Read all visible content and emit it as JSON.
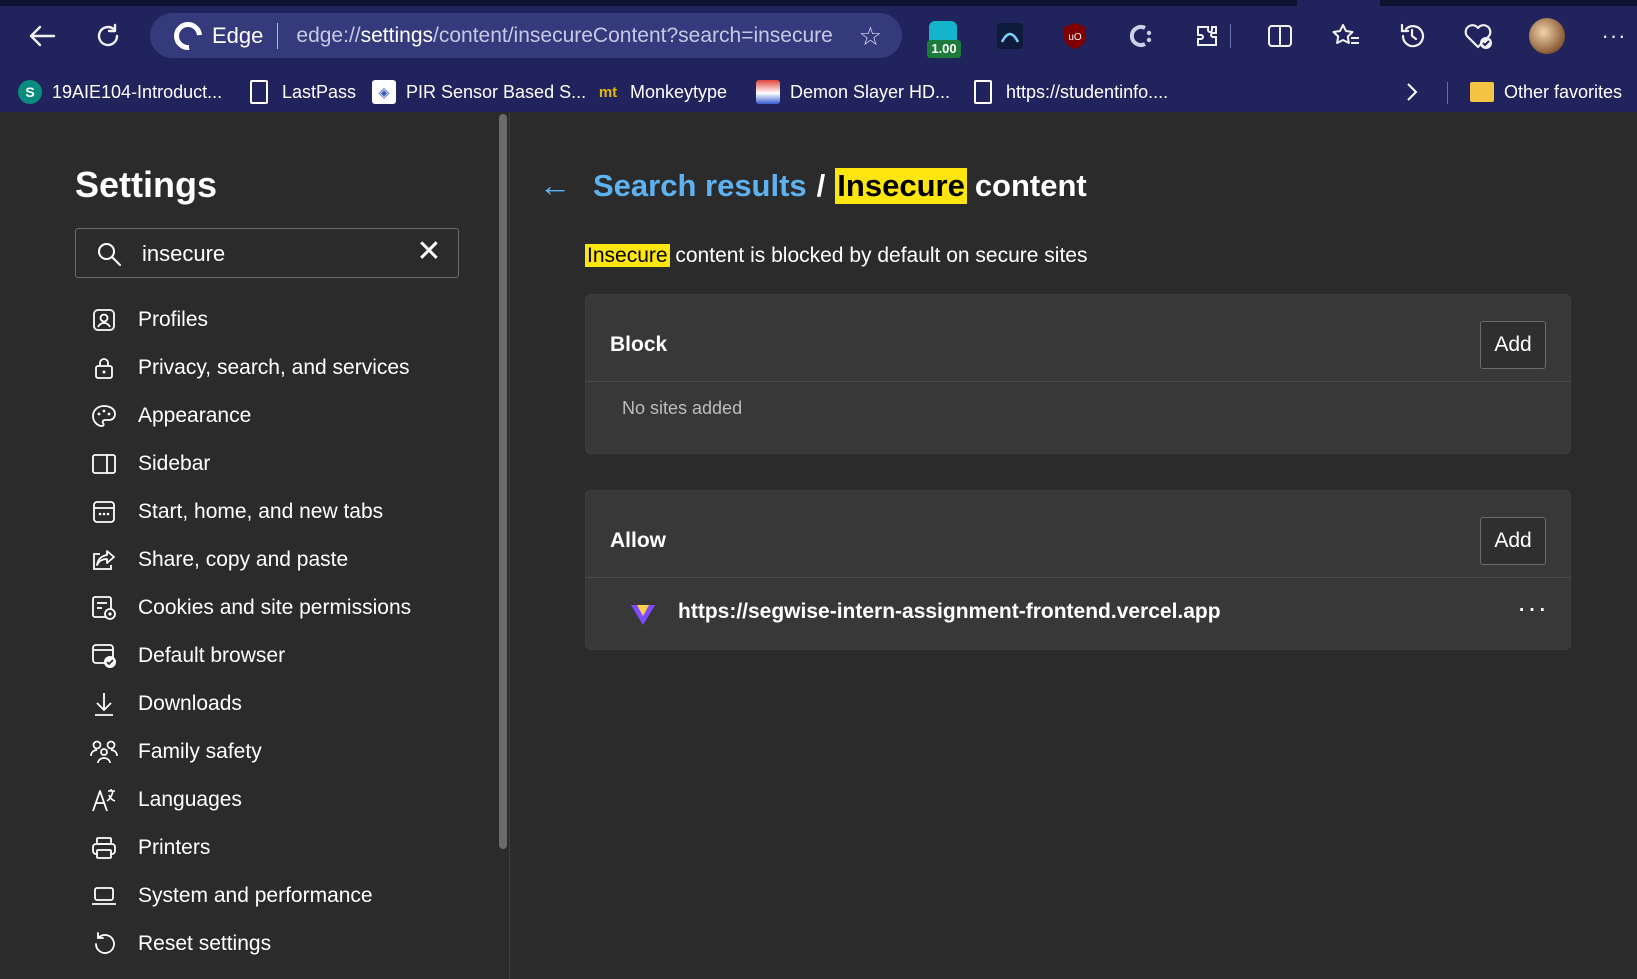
{
  "browser": {
    "brand": "Edge",
    "url_prefix": "edge://",
    "url_host": "settings",
    "url_path": "/content/insecureContent?search=insecure",
    "extension_badge": "1.00"
  },
  "favorites": {
    "items": [
      {
        "label": "19AIE104-Introduct...",
        "icon": "sharepoint-icon"
      },
      {
        "label": "LastPass",
        "icon": "document-icon"
      },
      {
        "label": "PIR Sensor Based S...",
        "icon": "site-icon"
      },
      {
        "label": "Monkeytype",
        "icon": "monkeytype-icon"
      },
      {
        "label": "Demon Slayer HD...",
        "icon": "site-icon"
      },
      {
        "label": "https://studentinfo....",
        "icon": "document-icon"
      }
    ],
    "other_label": "Other favorites"
  },
  "sidebar": {
    "title": "Settings",
    "search_value": "insecure",
    "items": [
      {
        "label": "Profiles"
      },
      {
        "label": "Privacy, search, and services"
      },
      {
        "label": "Appearance"
      },
      {
        "label": "Sidebar"
      },
      {
        "label": "Start, home, and new tabs"
      },
      {
        "label": "Share, copy and paste"
      },
      {
        "label": "Cookies and site permissions"
      },
      {
        "label": "Default browser"
      },
      {
        "label": "Downloads"
      },
      {
        "label": "Family safety"
      },
      {
        "label": "Languages"
      },
      {
        "label": "Printers"
      },
      {
        "label": "System and performance"
      },
      {
        "label": "Reset settings"
      }
    ]
  },
  "main": {
    "breadcrumb_link": "Search results",
    "breadcrumb_sep": "/",
    "breadcrumb_highlight": "Insecure",
    "breadcrumb_rest": "content",
    "subtitle_highlight": "Insecure",
    "subtitle_rest": " content is blocked by default on secure sites",
    "block": {
      "title": "Block",
      "add_label": "Add",
      "empty_text": "No sites added"
    },
    "allow": {
      "title": "Allow",
      "add_label": "Add",
      "sites": [
        {
          "url": "https://segwise-intern-assignment-frontend.vercel.app"
        }
      ],
      "more_label": "···"
    }
  },
  "colors": {
    "toolbar_bg": "#20235c",
    "page_bg": "#2b2b2b",
    "card_bg": "#383838",
    "link": "#5fb2f2",
    "highlight": "#fde510"
  }
}
